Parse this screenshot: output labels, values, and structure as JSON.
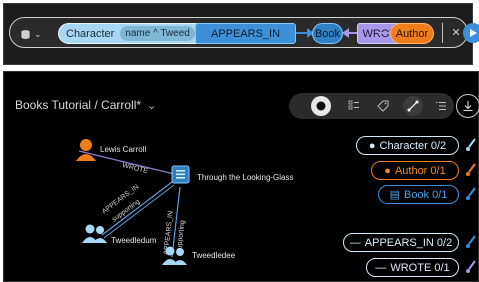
{
  "query_bar": {
    "node_character": {
      "label": "Character",
      "filter": "name ^ Tweed"
    },
    "relationship_appears_in": "APPEARS_IN",
    "node_book": "Book",
    "relationship_wrote": "WROTE",
    "node_author": "Author"
  },
  "graph_view": {
    "breadcrumb": "Books Tutorial / Carroll*",
    "toolbar": [
      "node-style",
      "list-view",
      "tag",
      "edge-style",
      "details"
    ],
    "nodes": {
      "lewis_carroll": "Lewis Carroll",
      "book": "Through the Looking-Glass",
      "tweedledum": "Tweedledum",
      "tweedledee": "Tweedledee"
    },
    "edges": {
      "wrote": "WROTE",
      "appears_in_dum": "APPEARS_IN",
      "supporting_dum": "supporting",
      "appears_in_dee": "APPEARS_IN",
      "supporting_dee": "supporting"
    },
    "legend": {
      "character": "Character 0/2",
      "author": "Author 0/1",
      "book": "Book 0/1",
      "appears_in": "APPEARS_IN 0/2",
      "wrote": "WROTE 0/1"
    }
  },
  "colors": {
    "character": "#a6d7f3",
    "author": "#f07d1c",
    "book": "#2f7fc6",
    "appears_in": "#3d8fd7",
    "wrote": "#a896e8",
    "accent": "#3b8fe0"
  }
}
